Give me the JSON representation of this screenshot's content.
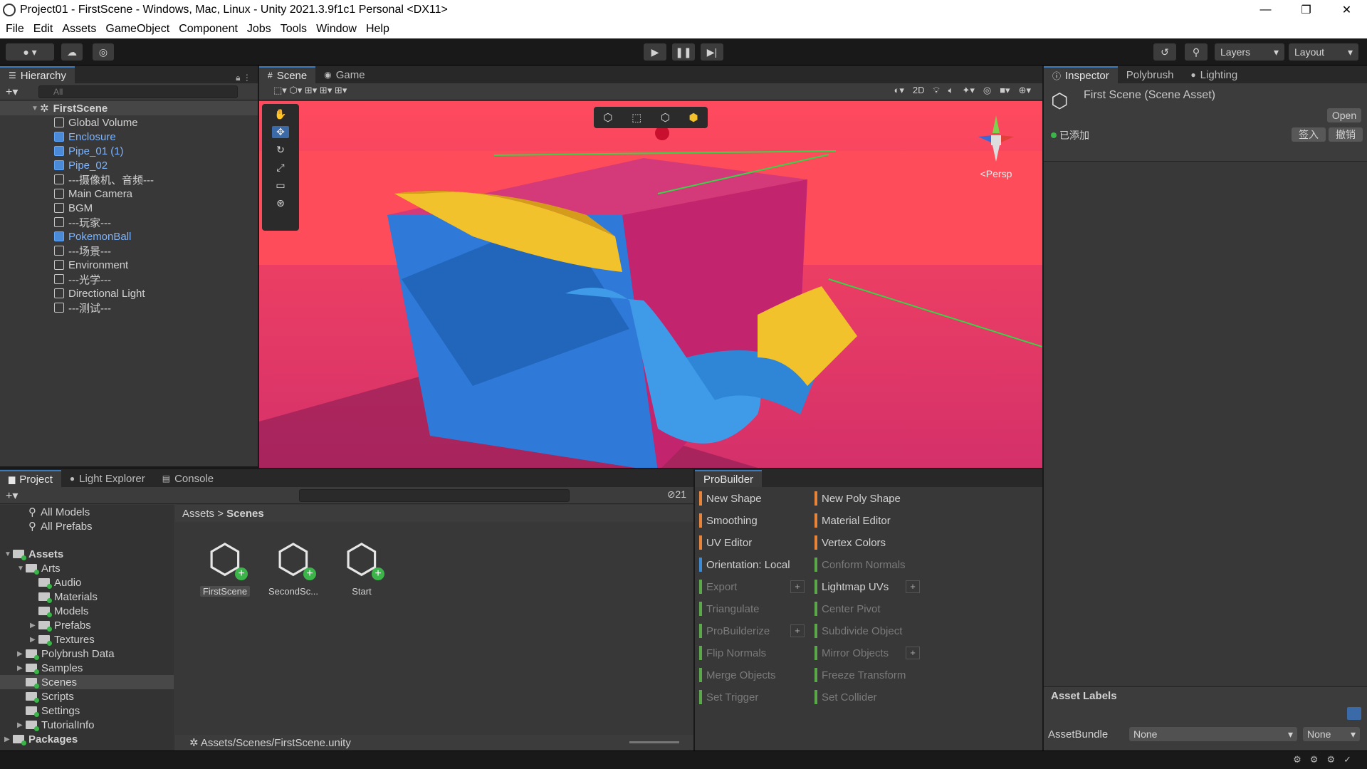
{
  "window": {
    "title": "Project01 - FirstScene - Windows, Mac, Linux - Unity 2021.3.9f1c1 Personal <DX11>",
    "min": "—",
    "max": "❐",
    "close": "✕"
  },
  "menu": [
    "File",
    "Edit",
    "Assets",
    "GameObject",
    "Component",
    "Jobs",
    "Tools",
    "Window",
    "Help"
  ],
  "toolbar": {
    "layers": "Layers",
    "layout": "Layout"
  },
  "hierarchy": {
    "tab": "Hierarchy",
    "search_placeholder": "All",
    "scene": "FirstScene",
    "items": [
      {
        "label": "Global Volume",
        "prefab": false
      },
      {
        "label": "Enclosure",
        "prefab": true
      },
      {
        "label": "Pipe_01 (1)",
        "prefab": true
      },
      {
        "label": "Pipe_02",
        "prefab": true
      },
      {
        "label": "---摄像机、音频---",
        "prefab": false
      },
      {
        "label": "Main Camera",
        "prefab": false
      },
      {
        "label": "BGM",
        "prefab": false
      },
      {
        "label": "---玩家---",
        "prefab": false
      },
      {
        "label": "PokemonBall",
        "prefab": true
      },
      {
        "label": "---场景---",
        "prefab": false
      },
      {
        "label": "Environment",
        "prefab": false
      },
      {
        "label": "---光学---",
        "prefab": false
      },
      {
        "label": "Directional Light",
        "prefab": false
      },
      {
        "label": "---测试---",
        "prefab": false
      }
    ]
  },
  "scene_view": {
    "tab_scene": "Scene",
    "tab_game": "Game",
    "btn_2d": "2D",
    "persp": "<Persp"
  },
  "inspector": {
    "tabs": [
      "Inspector",
      "Polybrush",
      "Lighting"
    ],
    "title": "First Scene (Scene Asset)",
    "open": "Open",
    "added": "已添加",
    "checkin": "签入",
    "revert": "撤销",
    "asset_labels": "Asset Labels",
    "assetbundle_label": "AssetBundle",
    "assetbundle_value": "None",
    "variant_value": "None"
  },
  "project": {
    "tabs": [
      "Project",
      "Light Explorer",
      "Console"
    ],
    "favorites": [
      "All Models",
      "All Prefabs"
    ],
    "assets_root": "Assets",
    "tree": [
      {
        "label": "Arts",
        "level": 1,
        "arrow": "▼"
      },
      {
        "label": "Audio",
        "level": 2,
        "arrow": ""
      },
      {
        "label": "Materials",
        "level": 2,
        "arrow": ""
      },
      {
        "label": "Models",
        "level": 2,
        "arrow": ""
      },
      {
        "label": "Prefabs",
        "level": 2,
        "arrow": "▶"
      },
      {
        "label": "Textures",
        "level": 2,
        "arrow": "▶"
      },
      {
        "label": "Polybrush Data",
        "level": 1,
        "arrow": "▶"
      },
      {
        "label": "Samples",
        "level": 1,
        "arrow": "▶"
      },
      {
        "label": "Scenes",
        "level": 1,
        "arrow": ""
      },
      {
        "label": "Scripts",
        "level": 1,
        "arrow": ""
      },
      {
        "label": "Settings",
        "level": 1,
        "arrow": ""
      },
      {
        "label": "TutorialInfo",
        "level": 1,
        "arrow": "▶"
      }
    ],
    "packages": "Packages",
    "breadcrumb": [
      "Assets",
      "Scenes"
    ],
    "hidden_count": "21",
    "files": [
      "FirstScene",
      "SecondSc...",
      "Start"
    ],
    "path": "Assets/Scenes/FirstScene.unity"
  },
  "probuilder": {
    "tab": "ProBuilder",
    "left": [
      {
        "label": "New Shape",
        "color": "#e8843a",
        "enabled": true,
        "plus": false
      },
      {
        "label": "Smoothing",
        "color": "#e8843a",
        "enabled": true,
        "plus": false
      },
      {
        "label": "UV Editor",
        "color": "#e8843a",
        "enabled": true,
        "plus": false
      },
      {
        "label": "Orientation: Local",
        "color": "#3a8ad6",
        "enabled": true,
        "plus": false
      },
      {
        "label": "Export",
        "color": "#5aa84a",
        "enabled": false,
        "plus": true
      },
      {
        "label": "Triangulate",
        "color": "#5aa84a",
        "enabled": false,
        "plus": false
      },
      {
        "label": "ProBuilderize",
        "color": "#5aa84a",
        "enabled": false,
        "plus": true
      },
      {
        "label": "Flip Normals",
        "color": "#5aa84a",
        "enabled": false,
        "plus": false
      },
      {
        "label": "Merge Objects",
        "color": "#5aa84a",
        "enabled": false,
        "plus": false
      },
      {
        "label": "Set Trigger",
        "color": "#5aa84a",
        "enabled": false,
        "plus": false
      }
    ],
    "right": [
      {
        "label": "New Poly Shape",
        "color": "#e8843a",
        "enabled": true,
        "plus": false
      },
      {
        "label": "Material Editor",
        "color": "#e8843a",
        "enabled": true,
        "plus": false
      },
      {
        "label": "Vertex Colors",
        "color": "#e8843a",
        "enabled": true,
        "plus": false
      },
      {
        "label": "Conform Normals",
        "color": "#5aa84a",
        "enabled": false,
        "plus": false
      },
      {
        "label": "Lightmap UVs",
        "color": "#5aa84a",
        "enabled": true,
        "plus": true
      },
      {
        "label": "Center Pivot",
        "color": "#5aa84a",
        "enabled": false,
        "plus": false
      },
      {
        "label": "Subdivide Object",
        "color": "#5aa84a",
        "enabled": false,
        "plus": false
      },
      {
        "label": "Mirror Objects",
        "color": "#5aa84a",
        "enabled": false,
        "plus": true
      },
      {
        "label": "Freeze Transform",
        "color": "#5aa84a",
        "enabled": false,
        "plus": false
      },
      {
        "label": "Set Collider",
        "color": "#5aa84a",
        "enabled": false,
        "plus": false
      }
    ]
  }
}
